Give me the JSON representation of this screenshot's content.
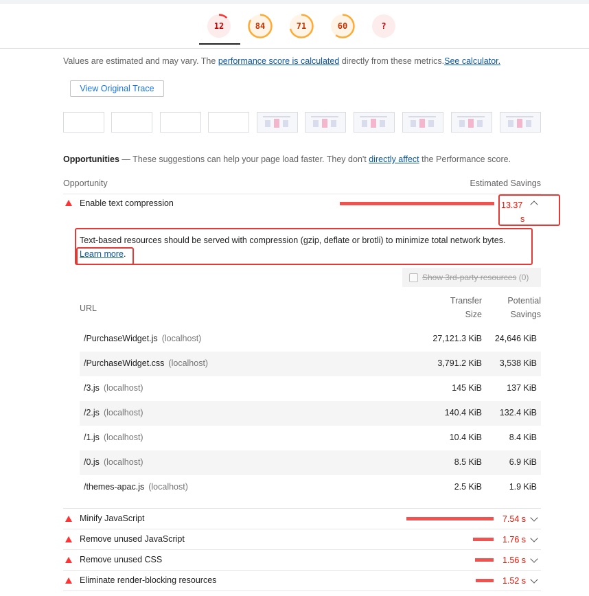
{
  "gauges": [
    {
      "label": "12",
      "score": 12,
      "color": "#f33"
    },
    {
      "label": "84",
      "score": 84,
      "color": "#fa3"
    },
    {
      "label": "71",
      "score": 71,
      "color": "#fa3"
    },
    {
      "label": "60",
      "score": 60,
      "color": "#fa3"
    },
    {
      "label": "?",
      "score": 0,
      "color": "#f33"
    }
  ],
  "values_note": {
    "prefix": "Values are estimated and may vary. The ",
    "link1": "performance score is calculated",
    "middle": " directly from these metrics.",
    "link2": "See calculator."
  },
  "view_trace_label": "View Original Trace",
  "opportunities": {
    "title": "Opportunities",
    "dash": " — These suggestions can help your page load faster. They don't ",
    "link": "directly affect",
    "suffix": " the Performance score."
  },
  "columns": {
    "left": "Opportunity",
    "right": "Estimated Savings"
  },
  "open_audit": {
    "title": "Enable text compression",
    "saving_num": "13.37",
    "saving_unit": "s",
    "description": "Text-based resources should be served with compression (gzip, deflate or brotli) to minimize total network bytes.",
    "learn_more": "Learn more",
    "period": "."
  },
  "third_party": {
    "label": "Show 3rd-party resources",
    "count": " (0)"
  },
  "table": {
    "headers": {
      "url": "URL",
      "transfer_1": "Transfer",
      "transfer_2": "Size",
      "savings_1": "Potential",
      "savings_2": "Savings"
    },
    "rows": [
      {
        "url": "/PurchaseWidget.js",
        "host": "(localhost)",
        "transfer": "27,121.3 KiB",
        "savings": "24,646 KiB"
      },
      {
        "url": "/PurchaseWidget.css",
        "host": "(localhost)",
        "transfer": "3,791.2 KiB",
        "savings": "3,538 KiB"
      },
      {
        "url": "/3.js",
        "host": "(localhost)",
        "transfer": "145 KiB",
        "savings": "137 KiB"
      },
      {
        "url": "/2.js",
        "host": "(localhost)",
        "transfer": "140.4 KiB",
        "savings": "132.4 KiB"
      },
      {
        "url": "/1.js",
        "host": "(localhost)",
        "transfer": "10.4 KiB",
        "savings": "8.4 KiB"
      },
      {
        "url": "/0.js",
        "host": "(localhost)",
        "transfer": "8.5 KiB",
        "savings": "6.9 KiB"
      },
      {
        "url": "/themes-apac.js",
        "host": "(localhost)",
        "transfer": "2.5 KiB",
        "savings": "1.9 KiB"
      }
    ]
  },
  "other_audits": [
    {
      "title": "Minify JavaScript",
      "saving": "7.54 s"
    },
    {
      "title": "Remove unused JavaScript",
      "saving": "1.76 s"
    },
    {
      "title": "Remove unused CSS",
      "saving": "1.56 s"
    },
    {
      "title": "Eliminate render-blocking resources",
      "saving": "1.52 s"
    }
  ],
  "colors": {
    "fail": "#f33",
    "average": "#fa3",
    "bar": "#ef5350",
    "link": "#0b57a0"
  }
}
